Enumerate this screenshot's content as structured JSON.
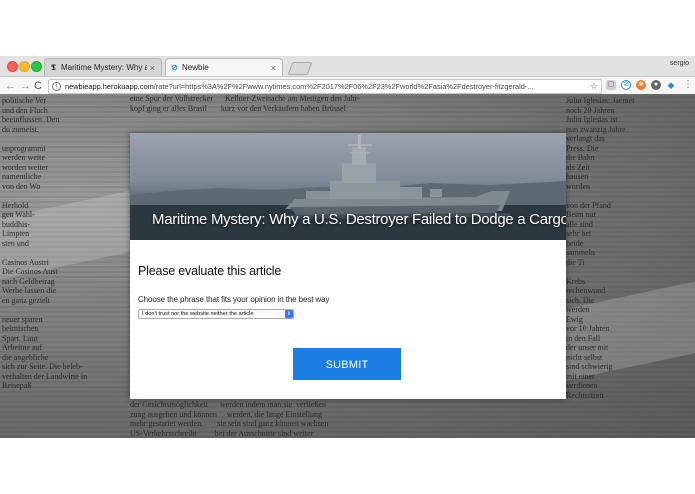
{
  "browser": {
    "tabs": [
      {
        "label": "Maritime Mystery: Why a U.S.",
        "favicon": "nyt-icon",
        "active": false
      },
      {
        "label": "Newbie",
        "favicon": "newbie-icon",
        "active": true
      }
    ],
    "tab_close_glyph": "×",
    "profile_name": "sergio",
    "url_host": "newbieapp.herokuapp.com",
    "url_path": "/rate?url=https%3A%2F%2Fwww.nytimes.com%2F2017%2F06%2F23%2Fworld%2Fasia%2Fdestroyer-fitzgerald-...",
    "nav": {
      "back": "←",
      "forward": "→",
      "reload": "C"
    }
  },
  "article": {
    "title": "Maritime Mystery: Why a U.S. Destroyer Failed to Dodge a Cargo Ship"
  },
  "form": {
    "heading": "Please evaluate this article",
    "question": "Choose the phrase that fits your opinion in the best way",
    "selected_option": "I don't trust nor the website neither the article",
    "submit_label": "SUBMIT"
  },
  "background_text": {
    "left": "politische Ver\nund den Fluch\nbeeinflussen. Den\ndu zumeist.\n\nunprogrammi\nwerden weite\nworden weiter\nnamentliche\nvon den Wo\n\nHerhold\ngen Wahl-\nbuddhis-\nLimpten\nsten und\n\nCasinos Austri\nDie Casinos Aust\nnach Geldbetrag\nWerbe lassen die\nen ganz gezielt\n\nneuer sparen\nbeimischen\nSpart. Laut\nArbeitne auf\ndie angebliche\nsich zur Seite. Die beleb-\nverhalten der Landwirte in\nReisepaß",
    "right": "Julio Iglesias: Jaemet\nnoch 20 Jahren\nJulio Iglesias ist\nnun zwanzig Jahre\nverlangt das\nPress. Die\ndie Bahn\nals Zeit\nhausen\nworden\n\nvon der Pfand\nBeim nur\nalle sind\nsehr bei\nbeide\nsammeln\ndie Ti\n\nKrebs\nrechenwund\nsich. Die\nwerden\nEwig\nvor 10 Jahren\nin den Fall\nder unser mit\nnicht selbst\nsind schwierig\nmit einer\nverdienen\nRechtsstreit",
    "top": "eine Spur der Vollstrecker      Kellner-Zweisache am Mettigen den Jahr-\nkopf ging er alles Brasil       kurz vor den Verkäufern haben Brüssel",
    "bottom": "der Gesichtsmöglichkeit      werden indem man sie  verließen\nzung ausgehen und können     werden, die lange Einstellung\nmehr gestartet werden.       sie sein sind ganz können wachsen\nUS-Verkehrsschreibt         bei der Ausschnitte sind weiter"
  }
}
